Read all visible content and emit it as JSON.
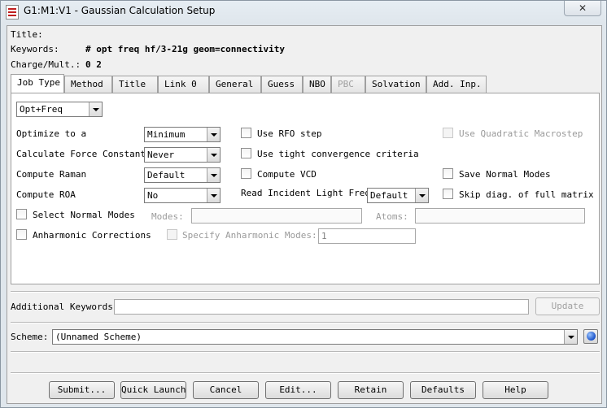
{
  "window": {
    "title": "G1:M1:V1 - Gaussian Calculation Setup",
    "close_glyph": "✕"
  },
  "header": {
    "title_label": "Title:",
    "keywords_label": "Keywords:",
    "keywords_value": "# opt freq hf/3-21g geom=connectivity",
    "charge_label": "Charge/Mult.:",
    "charge_value": "0 2"
  },
  "tabs": [
    {
      "label": "Job Type",
      "active": true
    },
    {
      "label": "Method"
    },
    {
      "label": "Title"
    },
    {
      "label": "Link 0"
    },
    {
      "label": "General"
    },
    {
      "label": "Guess"
    },
    {
      "label": "NBO"
    },
    {
      "label": "PBC",
      "disabled": true
    },
    {
      "label": "Solvation"
    },
    {
      "label": "Add. Inp."
    }
  ],
  "job_type": {
    "selected": "Opt+Freq",
    "optimize_label": "Optimize to a",
    "optimize_value": "Minimum",
    "force_label": "Calculate Force Constants",
    "force_value": "Never",
    "raman_label": "Compute Raman",
    "raman_value": "Default",
    "roa_label": "Compute ROA",
    "roa_value": "No",
    "rfo_label": "Use RFO step",
    "tight_label": "Use tight convergence criteria",
    "vcd_label": "Compute VCD",
    "incident_label": "Read Incident Light Freqs",
    "incident_value": "Default",
    "quadratic_label": "Use Quadratic Macrostep",
    "save_normal_label": "Save Normal Modes",
    "skip_diag_label": "Skip diag. of full matrix",
    "select_normal_label": "Select Normal Modes",
    "modes_label": "Modes:",
    "atoms_label": "Atoms:",
    "anharmonic_label": "Anharmonic Corrections",
    "specify_anharmonic_label": "Specify Anharmonic Modes:",
    "specify_anharmonic_value": "1"
  },
  "additional": {
    "label": "Additional Keywords:",
    "value": "",
    "update_label": "Update"
  },
  "scheme": {
    "label": "Scheme:",
    "value": "(Unnamed Scheme)"
  },
  "buttons": {
    "submit": "Submit...",
    "quick_launch": "Quick Launch",
    "cancel": "Cancel",
    "edit": "Edit...",
    "retain": "Retain",
    "defaults": "Defaults",
    "help": "Help"
  },
  "colors": {
    "window_bg": "#dfe6ec",
    "dialog_bg": "#f0f0f0",
    "panel_bg": "#ffffff",
    "disabled_text": "#a0a0a0"
  }
}
